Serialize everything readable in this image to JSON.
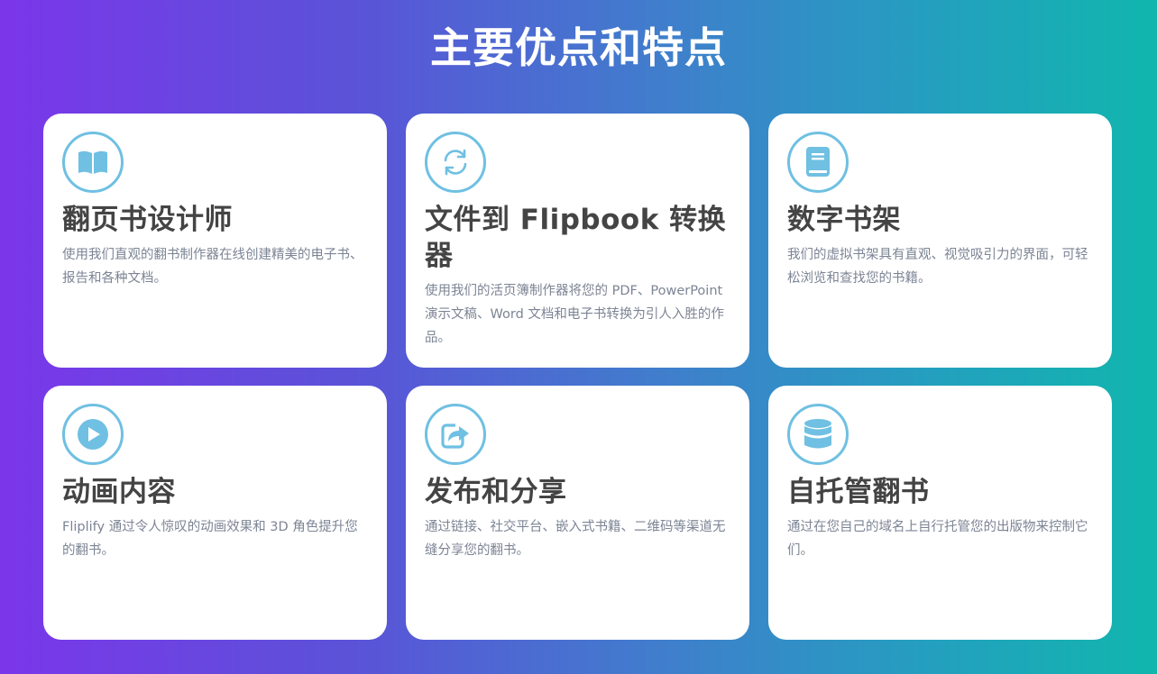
{
  "page": {
    "title": "主要优点和特点"
  },
  "colors": {
    "gradient_start": "#7b36ea",
    "gradient_end": "#11b6ad",
    "icon_accent": "#6fc0e2",
    "card_background": "#ffffff",
    "title_text": "#444444",
    "description_text": "#7c8494"
  },
  "features": [
    {
      "icon": "open-book-icon",
      "title": "翻页书设计师",
      "description": "使用我们直观的翻书制作器在线创建精美的电子书、报告和各种文档。"
    },
    {
      "icon": "refresh-icon",
      "title": "文件到 Flipbook 转换器",
      "description": "使用我们的活页簿制作器将您的 PDF、PowerPoint 演示文稿、Word 文档和电子书转换为引人入胜的作品。"
    },
    {
      "icon": "book-icon",
      "title": "数字书架",
      "description": "我们的虚拟书架具有直观、视觉吸引力的界面，可轻松浏览和查找您的书籍。"
    },
    {
      "icon": "play-circle-icon",
      "title": "动画内容",
      "description": "Fliplify 通过令人惊叹的动画效果和 3D 角色提升您的翻书。"
    },
    {
      "icon": "share-icon",
      "title": "发布和分享",
      "description": "通过链接、社交平台、嵌入式书籍、二维码等渠道无缝分享您的翻书。"
    },
    {
      "icon": "database-icon",
      "title": "自托管翻书",
      "description": "通过在您自己的域名上自行托管您的出版物来控制它们。"
    }
  ]
}
